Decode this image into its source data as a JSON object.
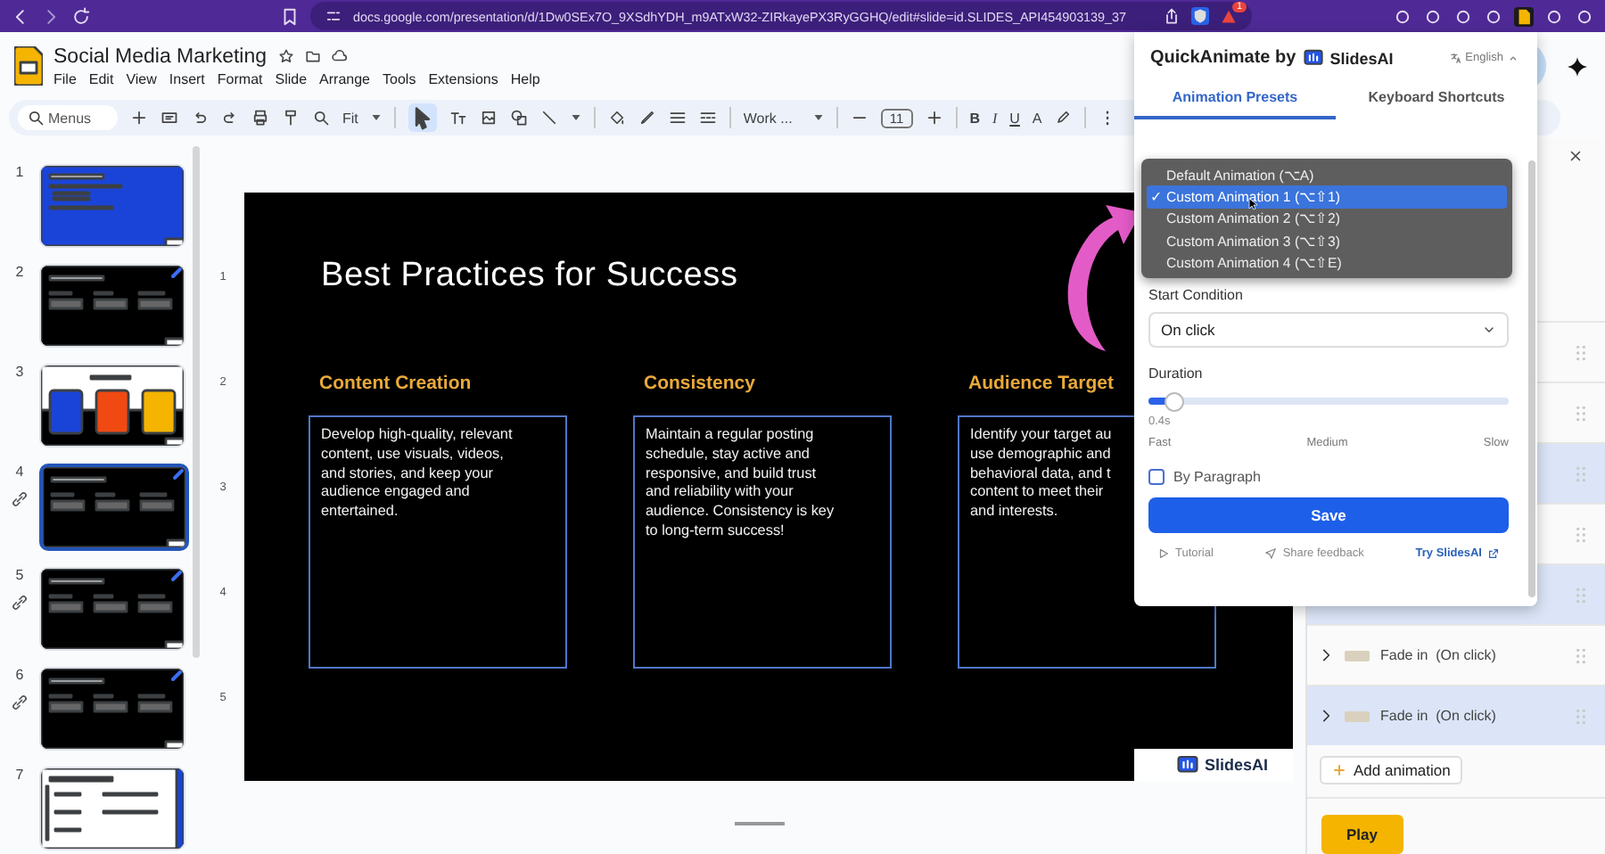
{
  "browser": {
    "url": "docs.google.com/presentation/d/1Dw0SEx7O_9XSdhYDH_m9ATxW32-ZIRkayePX3RyGGHQ/edit#slide=id.SLIDES_API454903139_37",
    "notification_count": "1"
  },
  "doc": {
    "title": "Social Media Marketing",
    "menu": [
      "File",
      "Edit",
      "View",
      "Insert",
      "Format",
      "Slide",
      "Arrange",
      "Tools",
      "Extensions",
      "Help"
    ]
  },
  "toolbar": {
    "search_placeholder": "Menus",
    "zoom": "Fit",
    "font": "Work ...",
    "font_size": "11",
    "format_keys": [
      "B",
      "I",
      "U",
      "A"
    ]
  },
  "slides": [
    {
      "number": "1",
      "kind": "blue",
      "selected": false,
      "linked": false
    },
    {
      "number": "2",
      "kind": "dark",
      "selected": false,
      "linked": false
    },
    {
      "number": "3",
      "kind": "cards",
      "selected": false,
      "linked": false
    },
    {
      "number": "4",
      "kind": "dark",
      "selected": true,
      "linked": true
    },
    {
      "number": "5",
      "kind": "dark",
      "selected": false,
      "linked": true
    },
    {
      "number": "6",
      "kind": "dark",
      "selected": false,
      "linked": true
    },
    {
      "number": "7",
      "kind": "light",
      "selected": false,
      "linked": false
    }
  ],
  "ruler": [
    "1",
    "2",
    "3",
    "4",
    "5"
  ],
  "slide": {
    "title": "Best Practices for Success",
    "badge": "SlidesAI",
    "columns": [
      {
        "heading": "Content Creation",
        "lines": [
          "Develop high-quality, relevant",
          "content, use visuals, videos,",
          "and stories, and keep your",
          "audience engaged and",
          "entertained."
        ]
      },
      {
        "heading": "Consistency",
        "lines": [
          "Maintain a regular posting",
          "schedule, stay active and",
          "responsive, and build trust",
          "and reliability with your",
          "audience. Consistency is key",
          "to long-term success!"
        ]
      },
      {
        "heading": "Audience Target",
        "lines": [
          "Identify your target au",
          "use demographic and",
          "behavioral data, and t",
          "content to meet their",
          "and interests."
        ]
      }
    ]
  },
  "popup": {
    "title": "QuickAnimate by",
    "brand": "SlidesAI",
    "language": "English",
    "tabs": [
      {
        "label": "Animation Presets",
        "selected": true
      },
      {
        "label": "Keyboard Shortcuts",
        "selected": false
      }
    ],
    "preset_options": [
      {
        "label": "Default Animation (⌥A)",
        "selected": false
      },
      {
        "label": "Custom Animation 1 (⌥⇧1)",
        "selected": true
      },
      {
        "label": "Custom Animation 2 (⌥⇧2)",
        "selected": false
      },
      {
        "label": "Custom Animation 3 (⌥⇧3)",
        "selected": false
      },
      {
        "label": "Custom Animation 4 (⌥⇧E)",
        "selected": false
      }
    ],
    "check_mark": "✓",
    "start_condition_label": "Start Condition",
    "start_condition": "On click",
    "duration_label": "Duration",
    "duration": {
      "level": 0.07,
      "reading": "0.4s"
    },
    "scale": [
      "Fast",
      "Medium",
      "Slow"
    ],
    "by_paragraph": {
      "label": "By Paragraph",
      "checked": false
    },
    "save": "Save",
    "tutorial": "Tutorial",
    "feedback": "Share feedback",
    "try": "Try SlidesAI"
  },
  "animations": {
    "rows": [
      {
        "selected": false
      },
      {
        "selected": false
      },
      {
        "selected": true
      },
      {
        "selected": false
      },
      {
        "selected": true
      },
      {
        "label": "Fade in  (On click)",
        "selected": false
      },
      {
        "label": "Fade in  (On click)",
        "selected": true
      }
    ],
    "add": "Add animation",
    "play": "Play"
  }
}
